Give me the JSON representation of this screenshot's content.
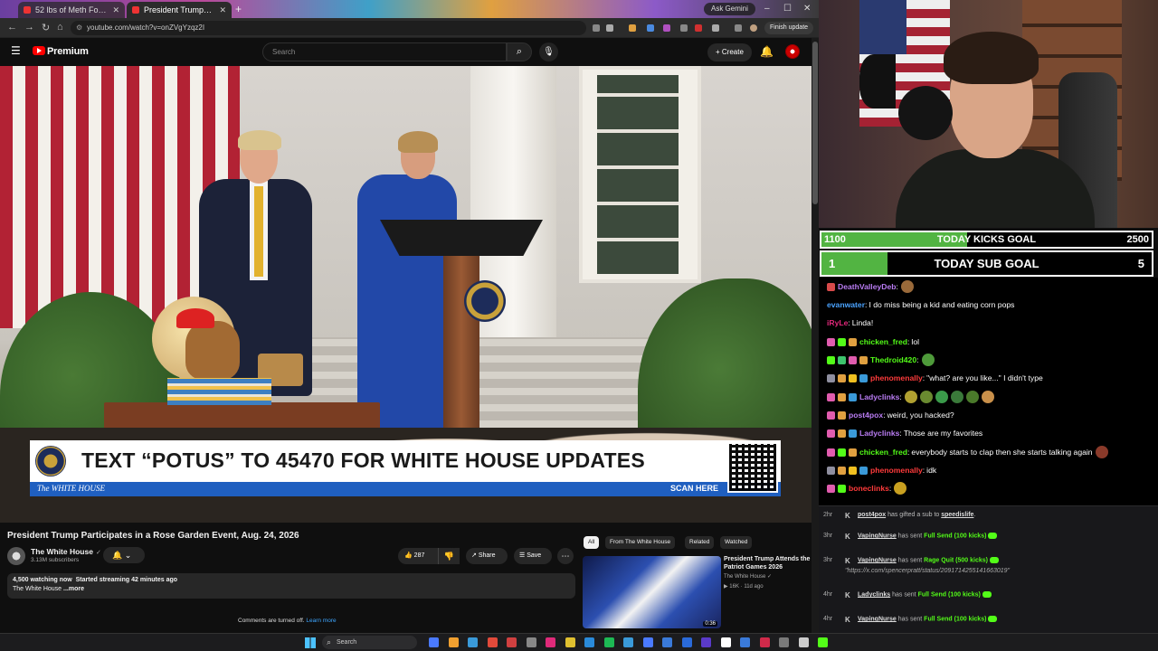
{
  "browser": {
    "tabs": [
      {
        "label": "52 lbs of Meth Found in His S..."
      },
      {
        "label": "President Trump Participat..."
      }
    ],
    "ask_gemini": "Ask Gemini",
    "url": "youtube.com/watch?v=onZVgYzqz2I",
    "finish_update": "Finish update"
  },
  "youtube": {
    "logo_text": "Premium",
    "search_placeholder": "Search",
    "create_label": "Create"
  },
  "banner": {
    "text": "TEXT “POTUS” TO 45470 FOR WHITE HOUSE UPDATES",
    "org": "The WHITE HOUSE",
    "scan": "SCAN HERE"
  },
  "video": {
    "title": "President Trump Participates in a Rose Garden Event, Aug. 24, 2026",
    "channel": "The White House",
    "subscribers": "3.13M subscribers",
    "likes": "287",
    "share_label": "Share",
    "save_label": "Save",
    "watching": "4,500 watching now",
    "started": "Started streaming 42 minutes ago",
    "desc": "The White House",
    "more": "...more",
    "comments_off": "Comments are turned off.",
    "learn_more": "Learn more"
  },
  "related": {
    "chips": [
      "All",
      "From The White House",
      "Related",
      "Watched"
    ],
    "item": {
      "title": "President Trump Attends the Patriot Games 2026",
      "channel": "The White House",
      "views": "16K",
      "age": "11d ago",
      "duration": "0:36"
    }
  },
  "goals": {
    "kick": {
      "current": "1100",
      "label": "TODAY KICKS GOAL",
      "target": "2500",
      "progress": 0.44
    },
    "sub": {
      "current": "1",
      "label": "TODAY SUB GOAL",
      "target": "5",
      "progress": 0.2
    }
  },
  "chat": [
    {
      "user": "DeathValleyDeb",
      "color": "#b97cf3",
      "message": "",
      "badges": [
        "#d84a4a"
      ],
      "emotes": [
        "#9a6a3a"
      ]
    },
    {
      "user": "evanwater",
      "color": "#4aa3ff",
      "message": "I do miss being a kid and eating corn pops",
      "badges": [],
      "emotes": []
    },
    {
      "user": "iRyLe",
      "color": "#e4287c",
      "message": "Linda!",
      "badges": [],
      "emotes": []
    },
    {
      "user": "chicken_fred",
      "color": "#53fc18",
      "message": "lol",
      "badges": [
        "#e05cae",
        "#53fc18",
        "#e0a040"
      ],
      "emotes": []
    },
    {
      "user": "Thedroid420",
      "color": "#53fc18",
      "message": "",
      "badges": [
        "#53fc18",
        "#3ec46d",
        "#e05cae",
        "#e0a040"
      ],
      "emotes": [
        "#4e9a3a"
      ]
    },
    {
      "user": "phenomenally",
      "color": "#ff3b3b",
      "message": "\"what? are you like...\" I didn't type",
      "badges": [
        "#8f8fa0",
        "#e0a040",
        "#f0c020",
        "#3a9ad9"
      ],
      "emotes": []
    },
    {
      "user": "Ladyclinks",
      "color": "#b97cf3",
      "message": "",
      "badges": [
        "#e05cae",
        "#e0a040",
        "#3a9ad9"
      ],
      "emotes": [
        "#b0a030",
        "#6a8a30",
        "#3a9a4a",
        "#3a7a3a",
        "#4a7a2a",
        "#c9904a"
      ]
    },
    {
      "user": "post4pox",
      "color": "#b97cf3",
      "message": "weird, you hacked?",
      "badges": [
        "#e05cae",
        "#e0a040"
      ],
      "emotes": []
    },
    {
      "user": "Ladyclinks",
      "color": "#b97cf3",
      "message": "Those are my favorites",
      "badges": [
        "#e05cae",
        "#e0a040",
        "#3a9ad9"
      ],
      "emotes": []
    },
    {
      "user": "chicken_fred",
      "color": "#53fc18",
      "message": "everybody starts to clap then she starts talking again",
      "badges": [
        "#e05cae",
        "#53fc18",
        "#e0a040"
      ],
      "emotes": [
        "#8a3a2a"
      ]
    },
    {
      "user": "phenomenally",
      "color": "#ff3b3b",
      "message": "idk",
      "badges": [
        "#8f8fa0",
        "#e0a040",
        "#f0c020",
        "#3a9ad9"
      ],
      "emotes": []
    },
    {
      "user": "boneclinks",
      "color": "#ff3b3b",
      "message": "",
      "badges": [
        "#e05cae",
        "#53fc18"
      ],
      "emotes": [
        "#c9a020"
      ]
    }
  ],
  "events": [
    {
      "time": "2hr",
      "user": "post4pox",
      "pre": "has gifted a sub to",
      "target": "speedislife",
      "suffix": ".",
      "gift": "",
      "link": ""
    },
    {
      "time": "3hr",
      "user": "VapingNurse",
      "pre": "has sent",
      "target": "",
      "suffix": "",
      "gift": "Full Send (100 kicks)",
      "link": ""
    },
    {
      "time": "3hr",
      "user": "VapingNurse",
      "pre": "has sent",
      "target": "",
      "suffix": "",
      "gift": "Rage Quit (500 kicks)",
      "link": "\"https://x.com/spencerpratt/status/2091714255141663019\""
    },
    {
      "time": "4hr",
      "user": "Ladyclinks",
      "pre": "has sent",
      "target": "",
      "suffix": "",
      "gift": "Full Send (100 kicks)",
      "link": ""
    },
    {
      "time": "4hr",
      "user": "VapingNurse",
      "pre": "has sent",
      "target": "",
      "suffix": "",
      "gift": "Full Send (100 kicks)",
      "link": ""
    },
    {
      "time": "4hr",
      "user": "VapingNurse",
      "pre": "has sent",
      "target": "",
      "suffix": "",
      "gift": "Full Send (100 kicks)",
      "link": ""
    }
  ],
  "taskbar": {
    "search_label": "Search",
    "icons": [
      "#4a7aff",
      "#f0a030",
      "#3a9ad9",
      "#e24a3a",
      "#d04040",
      "#888888",
      "#e02a7a",
      "#e0c030",
      "#2a8ad9",
      "#1db954",
      "#3a9ad9",
      "#4a7aff",
      "#3a7ad9",
      "#2a6ad9",
      "#5a3ac9",
      "#ffffff",
      "#3a7ad9",
      "#d02a4a",
      "#7a7a7a",
      "#cccccc",
      "#53fc18"
    ]
  }
}
